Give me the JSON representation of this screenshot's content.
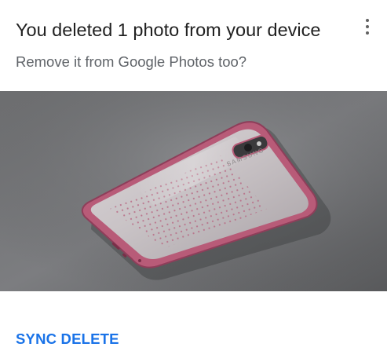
{
  "dialog": {
    "title": "You deleted 1 photo from your device",
    "subtitle": "Remove it from Google Photos too?",
    "menu_icon": "more-vert-icon",
    "photo": {
      "subject": "phone-in-clear-case",
      "phone_brand_text": "SAMSUNG"
    },
    "action_label": "SYNC DELETE"
  },
  "colors": {
    "title_text": "#212121",
    "subtitle_text": "#5f6368",
    "action_text": "#1a73e8",
    "background": "#ffffff",
    "case_rim": "#b85b78"
  }
}
